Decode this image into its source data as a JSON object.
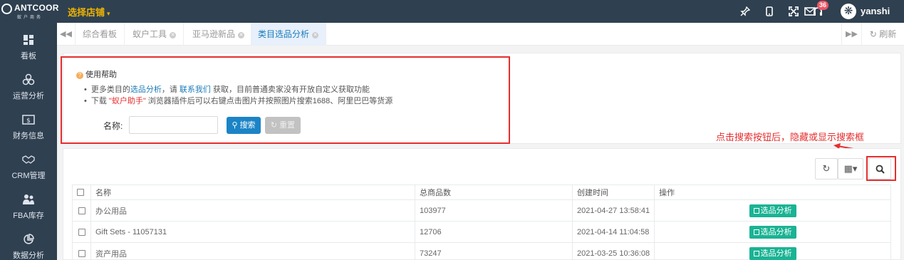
{
  "brand": {
    "name": "ANTCOOR",
    "sub": "蚁户商务"
  },
  "header": {
    "shop_select": "选择店铺",
    "notification_count": "36",
    "username": "yanshi",
    "icons": [
      "pin-icon",
      "mobile-icon",
      "fullscreen-icon",
      "headset-icon",
      "mail-icon"
    ]
  },
  "sidebar": {
    "items": [
      {
        "label": "看板",
        "icon": "dashboard-icon"
      },
      {
        "label": "运营分析",
        "icon": "operation-icon"
      },
      {
        "label": "财务信息",
        "icon": "finance-icon"
      },
      {
        "label": "CRM管理",
        "icon": "handshake-icon"
      },
      {
        "label": "FBA库存",
        "icon": "users-icon"
      },
      {
        "label": "数据分析",
        "icon": "pie-chart-icon"
      }
    ]
  },
  "tabs": {
    "items": [
      {
        "label": "综合看板"
      },
      {
        "label": "蚁户工具"
      },
      {
        "label": "亚马逊新品"
      },
      {
        "label": "类目选品分析"
      }
    ],
    "refresh_label": "刷新"
  },
  "help": {
    "title": "使用帮助",
    "line1": {
      "pre": "更多类目的",
      "link1": "选品分析",
      "mid": "，请 ",
      "link2": "联系我们",
      "post": " 获取，目前普通卖家没有开放自定义获取功能"
    },
    "line2": {
      "pre": "下载 ",
      "highlight": "\"蚁户助手\"",
      "post": " 浏览器插件后可以右键点击图片并按照图片搜索1688、阿里巴巴等货源"
    }
  },
  "search_form": {
    "name_label": "名称:",
    "name_value": "",
    "search_button": "搜索",
    "reset_button": "重置"
  },
  "annotation": "点击搜索按钮后，隐藏或显示搜索框",
  "table": {
    "columns": [
      "名称",
      "总商品数",
      "创建时间",
      "操作"
    ],
    "rows": [
      {
        "name": "办公用品",
        "total": "103977",
        "created": "2021-04-27 13:58:41",
        "action": "选品分析"
      },
      {
        "name": "Gift Sets - 11057131",
        "total": "12706",
        "created": "2021-04-14 11:04:58",
        "action": "选品分析"
      },
      {
        "name": "资产用品",
        "total": "73247",
        "created": "2021-03-25 10:36:08",
        "action": "选品分析"
      }
    ]
  },
  "colors": {
    "sidebar_bg": "#2f4050",
    "accent": "#1c84c6",
    "action_green": "#1ab394",
    "annotation_red": "#e52e2e"
  }
}
